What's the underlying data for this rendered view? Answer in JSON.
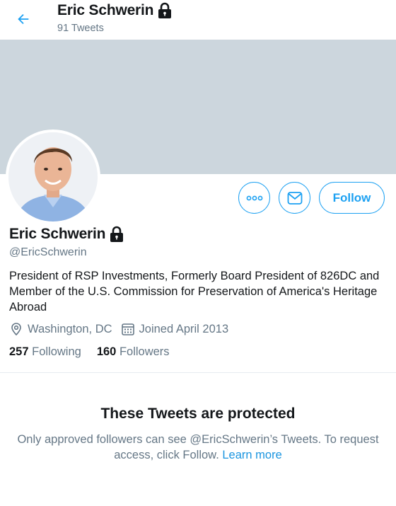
{
  "header": {
    "name": "Eric Schwerin",
    "tweet_count": "91 Tweets"
  },
  "profile": {
    "name": "Eric Schwerin",
    "handle": "@EricSchwerin",
    "bio": "President of RSP Investments, Formerly Board President of 826DC and Member of the U.S. Commission for Preservation of America's Heritage Abroad",
    "location": "Washington, DC",
    "joined": "Joined April 2013",
    "following_count": "257",
    "following_label": "Following",
    "followers_count": "160",
    "followers_label": "Followers"
  },
  "actions": {
    "follow_label": "Follow"
  },
  "protected": {
    "title": "These Tweets are protected",
    "message": "Only approved followers can see @EricSchwerin’s Tweets. To request access, click Follow.",
    "learn_more": "Learn more"
  },
  "colors": {
    "accent": "#1da1f2",
    "banner": "#ccd6dd",
    "secondary_text": "#657786"
  },
  "icons": [
    "back-arrow-icon",
    "lock-icon",
    "more-icon",
    "message-icon",
    "location-icon",
    "calendar-icon"
  ]
}
